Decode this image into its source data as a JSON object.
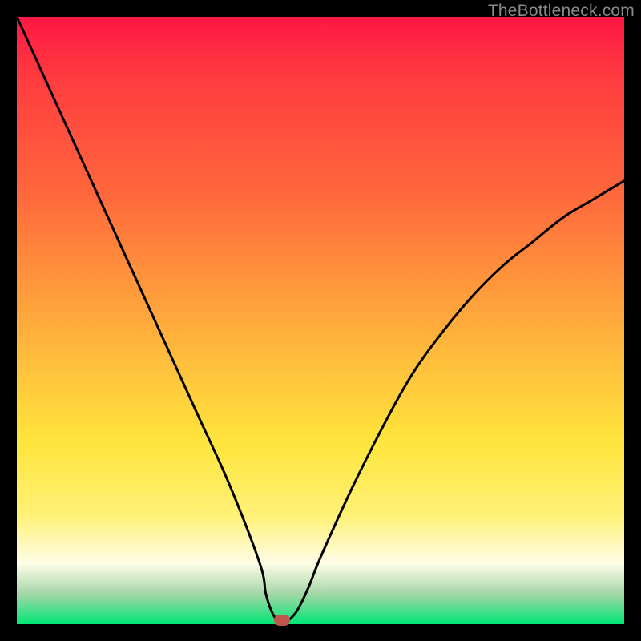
{
  "watermark": "TheBottleneck.com",
  "marker": {
    "x_frac": 0.437,
    "y_frac": 0.994
  },
  "colors": {
    "curve": "#000000",
    "marker": "#c0574e",
    "frame_bg": "#000000",
    "gradient_top": "#ff1744",
    "gradient_bottom": "#00e676"
  },
  "chart_data": {
    "type": "line",
    "title": "",
    "xlabel": "",
    "ylabel": "",
    "xlim": [
      0,
      100
    ],
    "ylim": [
      0,
      100
    ],
    "annotations": [
      "TheBottleneck.com"
    ],
    "series": [
      {
        "name": "bottleneck-curve-left",
        "x": [
          0,
          5,
          10,
          15,
          20,
          25,
          30,
          35,
          40,
          41,
          42,
          43,
          44
        ],
        "values": [
          100,
          89,
          78,
          67,
          56,
          45,
          34,
          23,
          10,
          5,
          2,
          0.5,
          0
        ]
      },
      {
        "name": "bottleneck-curve-right",
        "x": [
          44,
          46,
          48,
          50,
          55,
          60,
          65,
          70,
          75,
          80,
          85,
          90,
          95,
          100
        ],
        "values": [
          0,
          2,
          6,
          11,
          22,
          32,
          41,
          48,
          54,
          59,
          63,
          67,
          70,
          73
        ]
      }
    ],
    "marker_point": {
      "x": 44,
      "y": 0
    },
    "background_gradient": {
      "orientation": "vertical",
      "stops": [
        {
          "pos": 0.0,
          "color": "#ff1744"
        },
        {
          "pos": 0.3,
          "color": "#ff6a3c"
        },
        {
          "pos": 0.6,
          "color": "#ffc23c"
        },
        {
          "pos": 0.85,
          "color": "#fff176"
        },
        {
          "pos": 1.0,
          "color": "#00e676"
        }
      ]
    }
  }
}
